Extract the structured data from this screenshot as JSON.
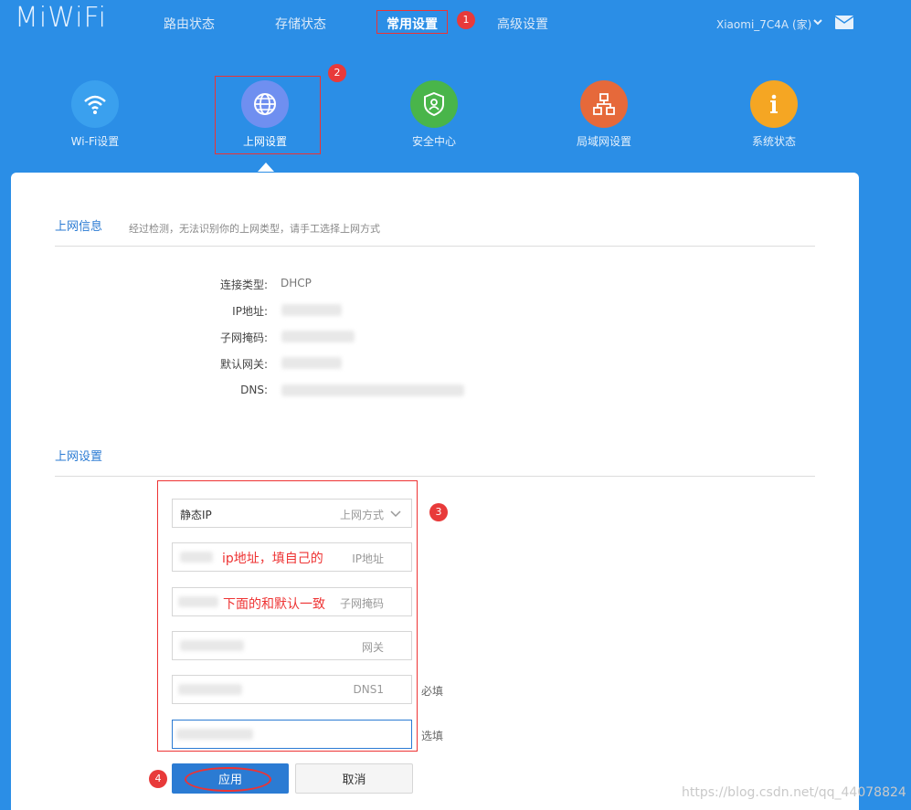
{
  "header": {
    "logo": "MiWiFi",
    "nav": [
      "路由状态",
      "存储状态",
      "常用设置",
      "高级设置"
    ],
    "user": "Xiaomi_7C4A (家)"
  },
  "annotations": {
    "badge1": "1",
    "badge2": "2",
    "badge3": "3",
    "badge4": "4",
    "ip_note": "ip地址，填自己的",
    "mask_note": "下面的和默认一致"
  },
  "tiles": [
    {
      "label": "Wi-Fi设置",
      "icon": "wifi-icon",
      "color": "#3aa0ee"
    },
    {
      "label": "上网设置",
      "icon": "globe-icon",
      "color": "#6f8ff0"
    },
    {
      "label": "安全中心",
      "icon": "shield-icon",
      "color": "#49b54a"
    },
    {
      "label": "局域网设置",
      "icon": "network-icon",
      "color": "#e6693a"
    },
    {
      "label": "系统状态",
      "icon": "info-icon",
      "color": "#f5a623"
    }
  ],
  "info": {
    "title": "上网信息",
    "desc": "经过检测，无法识别你的上网类型，请手工选择上网方式",
    "rows": [
      {
        "label": "连接类型:",
        "value": "DHCP"
      },
      {
        "label": "IP地址:",
        "value": ""
      },
      {
        "label": "子网掩码:",
        "value": ""
      },
      {
        "label": "默认网关:",
        "value": ""
      },
      {
        "label": "DNS:",
        "value": ""
      }
    ]
  },
  "settings": {
    "title": "上网设置",
    "mode_value": "静态IP",
    "mode_placeholder": "上网方式",
    "ip_placeholder": "IP地址",
    "mask_placeholder": "子网掩码",
    "gateway_placeholder": "网关",
    "dns1_placeholder": "DNS1",
    "dns1_req": "必填",
    "dns2_req": "选填",
    "apply": "应用",
    "cancel": "取消"
  },
  "watermark": "https://blog.csdn.net/qq_44078824"
}
